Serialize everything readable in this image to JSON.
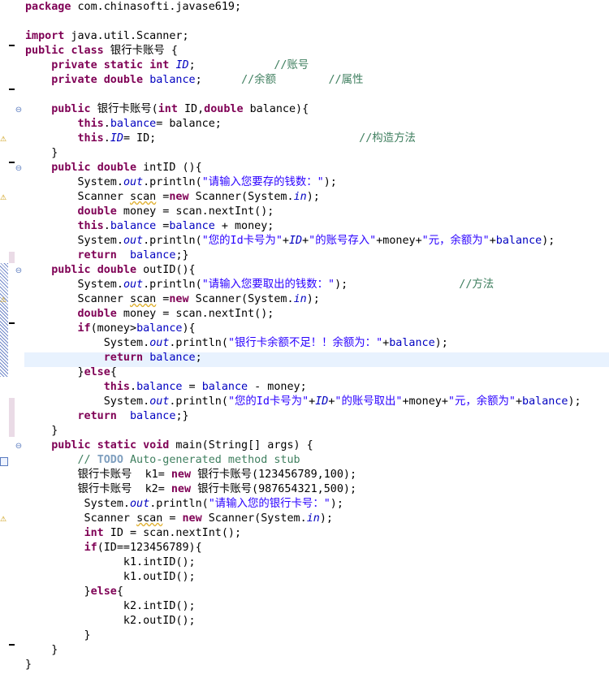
{
  "editor": {
    "lines": [
      [
        [
          "kw",
          "package"
        ],
        [
          "t",
          " com.chinasofti.javase619;"
        ]
      ],
      [],
      [
        [
          "kw",
          "import"
        ],
        [
          "t",
          " java.util.Scanner;"
        ]
      ],
      [
        [
          "kw",
          "public"
        ],
        [
          "t",
          " "
        ],
        [
          "kw",
          "class"
        ],
        [
          "t",
          " 银行卡账号 {"
        ]
      ],
      [
        [
          "t",
          "    "
        ],
        [
          "kw",
          "private"
        ],
        [
          "t",
          " "
        ],
        [
          "kw",
          "static"
        ],
        [
          "t",
          " "
        ],
        [
          "kw",
          "int"
        ],
        [
          "t",
          " "
        ],
        [
          "sfld",
          "ID"
        ],
        [
          "t",
          ";            "
        ],
        [
          "cm",
          "//账号"
        ]
      ],
      [
        [
          "t",
          "    "
        ],
        [
          "kw",
          "private"
        ],
        [
          "t",
          " "
        ],
        [
          "kw",
          "double"
        ],
        [
          "t",
          " "
        ],
        [
          "fld",
          "balance"
        ],
        [
          "t",
          ";      "
        ],
        [
          "cm",
          "//余额        //属性"
        ]
      ],
      [],
      [
        [
          "t",
          "    "
        ],
        [
          "kw",
          "public"
        ],
        [
          "t",
          " 银行卡账号("
        ],
        [
          "kw",
          "int"
        ],
        [
          "t",
          " ID,"
        ],
        [
          "kw",
          "double"
        ],
        [
          "t",
          " balance){"
        ]
      ],
      [
        [
          "t",
          "        "
        ],
        [
          "kw",
          "this"
        ],
        [
          "t",
          "."
        ],
        [
          "fld",
          "balance"
        ],
        [
          "t",
          "= balance;"
        ]
      ],
      [
        [
          "t",
          "        "
        ],
        [
          "kw",
          "this"
        ],
        [
          "t",
          "."
        ],
        [
          "sfld",
          "ID"
        ],
        [
          "t",
          "= ID;                               "
        ],
        [
          "cm",
          "//构造方法"
        ]
      ],
      [
        [
          "t",
          "    }"
        ]
      ],
      [
        [
          "t",
          "    "
        ],
        [
          "kw",
          "public"
        ],
        [
          "t",
          " "
        ],
        [
          "kw",
          "double"
        ],
        [
          "t",
          " intID (){"
        ]
      ],
      [
        [
          "t",
          "        System."
        ],
        [
          "sfld",
          "out"
        ],
        [
          "t",
          ".println("
        ],
        [
          "str",
          "\"请输入您要存的钱数：\""
        ],
        [
          "t",
          ");"
        ]
      ],
      [
        [
          "t",
          "        Scanner "
        ],
        [
          "warn",
          "scan"
        ],
        [
          "t",
          " ="
        ],
        [
          "kw",
          "new"
        ],
        [
          "t",
          " Scanner(System."
        ],
        [
          "sfld",
          "in"
        ],
        [
          "t",
          ");"
        ]
      ],
      [
        [
          "t",
          "        "
        ],
        [
          "kw",
          "double"
        ],
        [
          "t",
          " money = scan.nextInt();"
        ]
      ],
      [
        [
          "t",
          "        "
        ],
        [
          "kw",
          "this"
        ],
        [
          "t",
          "."
        ],
        [
          "fld",
          "balance"
        ],
        [
          "t",
          " ="
        ],
        [
          "fld",
          "balance"
        ],
        [
          "t",
          " + money;"
        ]
      ],
      [
        [
          "t",
          "        System."
        ],
        [
          "sfld",
          "out"
        ],
        [
          "t",
          ".println("
        ],
        [
          "str",
          "\"您的Id卡号为\""
        ],
        [
          "t",
          "+"
        ],
        [
          "sfld",
          "ID"
        ],
        [
          "t",
          "+"
        ],
        [
          "str",
          "\"的账号存入\""
        ],
        [
          "t",
          "+money+"
        ],
        [
          "str",
          "\"元，余额为\""
        ],
        [
          "t",
          "+"
        ],
        [
          "fld",
          "balance"
        ],
        [
          "t",
          ");"
        ]
      ],
      [
        [
          "t",
          "        "
        ],
        [
          "kw",
          "return"
        ],
        [
          "t",
          "  "
        ],
        [
          "fld",
          "balance"
        ],
        [
          "t",
          ";}"
        ]
      ],
      [
        [
          "t",
          "    "
        ],
        [
          "kw",
          "public"
        ],
        [
          "t",
          " "
        ],
        [
          "kw",
          "double"
        ],
        [
          "t",
          " outID(){"
        ]
      ],
      [
        [
          "t",
          "        System."
        ],
        [
          "sfld",
          "out"
        ],
        [
          "t",
          ".println("
        ],
        [
          "str",
          "\"请输入您要取出的钱数：\""
        ],
        [
          "t",
          ");                 "
        ],
        [
          "cm",
          "//方法"
        ]
      ],
      [
        [
          "t",
          "        Scanner "
        ],
        [
          "warn",
          "scan"
        ],
        [
          "t",
          " ="
        ],
        [
          "kw",
          "new"
        ],
        [
          "t",
          " Scanner(System."
        ],
        [
          "sfld",
          "in"
        ],
        [
          "t",
          ");"
        ]
      ],
      [
        [
          "t",
          "        "
        ],
        [
          "kw",
          "double"
        ],
        [
          "t",
          " money = scan.nextInt();"
        ]
      ],
      [
        [
          "t",
          "        "
        ],
        [
          "kw",
          "if"
        ],
        [
          "t",
          "(money>"
        ],
        [
          "fld",
          "balance"
        ],
        [
          "t",
          "){"
        ]
      ],
      [
        [
          "t",
          "            System."
        ],
        [
          "sfld",
          "out"
        ],
        [
          "t",
          ".println("
        ],
        [
          "str",
          "\"银行卡余额不足！！余额为：\""
        ],
        [
          "t",
          "+"
        ],
        [
          "fld",
          "balance"
        ],
        [
          "t",
          ");"
        ]
      ],
      [
        [
          "t",
          "            "
        ],
        [
          "kw",
          "return"
        ],
        [
          "t",
          " "
        ],
        [
          "fld",
          "balance"
        ],
        [
          "t",
          ";"
        ]
      ],
      [
        [
          "t",
          "        }"
        ],
        [
          "kw",
          "else"
        ],
        [
          "t",
          "{"
        ]
      ],
      [
        [
          "t",
          "            "
        ],
        [
          "kw",
          "this"
        ],
        [
          "t",
          "."
        ],
        [
          "fld",
          "balance"
        ],
        [
          "t",
          " = "
        ],
        [
          "fld",
          "balance"
        ],
        [
          "t",
          " - money;"
        ]
      ],
      [
        [
          "t",
          "            System."
        ],
        [
          "sfld",
          "out"
        ],
        [
          "t",
          ".println("
        ],
        [
          "str",
          "\"您的Id卡号为\""
        ],
        [
          "t",
          "+"
        ],
        [
          "sfld",
          "ID"
        ],
        [
          "t",
          "+"
        ],
        [
          "str",
          "\"的账号取出\""
        ],
        [
          "t",
          "+money+"
        ],
        [
          "str",
          "\"元，余额为\""
        ],
        [
          "t",
          "+"
        ],
        [
          "fld",
          "balance"
        ],
        [
          "t",
          ");"
        ]
      ],
      [
        [
          "t",
          "        "
        ],
        [
          "kw",
          "return"
        ],
        [
          "t",
          "  "
        ],
        [
          "fld",
          "balance"
        ],
        [
          "t",
          ";}"
        ]
      ],
      [
        [
          "t",
          "    }"
        ]
      ],
      [
        [
          "t",
          "    "
        ],
        [
          "kw",
          "public"
        ],
        [
          "t",
          " "
        ],
        [
          "kw",
          "static"
        ],
        [
          "t",
          " "
        ],
        [
          "kw",
          "void"
        ],
        [
          "t",
          " main(String[] args) {"
        ]
      ],
      [
        [
          "t",
          "        "
        ],
        [
          "cm",
          "// "
        ],
        [
          "task",
          "TODO"
        ],
        [
          "cm",
          " Auto-generated method stub"
        ]
      ],
      [
        [
          "t",
          "        银行卡账号  k1= "
        ],
        [
          "kw",
          "new"
        ],
        [
          "t",
          " 银行卡账号(123456789,100);"
        ]
      ],
      [
        [
          "t",
          "        银行卡账号  k2= "
        ],
        [
          "kw",
          "new"
        ],
        [
          "t",
          " 银行卡账号(987654321,500);"
        ]
      ],
      [
        [
          "t",
          "         System."
        ],
        [
          "sfld",
          "out"
        ],
        [
          "t",
          ".println("
        ],
        [
          "str",
          "\"请输入您的银行卡号：\""
        ],
        [
          "t",
          ");"
        ]
      ],
      [
        [
          "t",
          "         Scanner "
        ],
        [
          "warn",
          "scan"
        ],
        [
          "t",
          " = "
        ],
        [
          "kw",
          "new"
        ],
        [
          "t",
          " Scanner(System."
        ],
        [
          "sfld",
          "in"
        ],
        [
          "t",
          ");"
        ]
      ],
      [
        [
          "t",
          "         "
        ],
        [
          "kw",
          "int"
        ],
        [
          "t",
          " ID = scan.nextInt();"
        ]
      ],
      [
        [
          "t",
          "         "
        ],
        [
          "kw",
          "if"
        ],
        [
          "t",
          "(ID==123456789){"
        ]
      ],
      [
        [
          "t",
          "               k1.intID();"
        ]
      ],
      [
        [
          "t",
          "               k1.outID();"
        ]
      ],
      [
        [
          "t",
          "         }"
        ],
        [
          "kw",
          "else"
        ],
        [
          "t",
          "{"
        ]
      ],
      [
        [
          "t",
          "               k2.intID();"
        ]
      ],
      [
        [
          "t",
          "               k2.outID();"
        ]
      ],
      [
        [
          "t",
          "         }"
        ]
      ],
      [
        [
          "t",
          "    }"
        ]
      ],
      [
        [
          "t",
          "}"
        ]
      ]
    ]
  },
  "gutter": {
    "warning_icon": "warning-icon",
    "task_icon": "task-icon",
    "fold_icon": "collapse-icon"
  }
}
